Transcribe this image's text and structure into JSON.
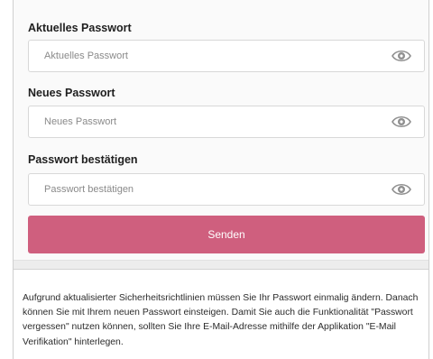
{
  "form": {
    "current": {
      "label": "Aktuelles Passwort",
      "placeholder": "Aktuelles Passwort"
    },
    "new": {
      "label": "Neues Passwort",
      "placeholder": "Neues Passwort"
    },
    "confirm": {
      "label": "Passwort bestätigen",
      "placeholder": "Passwort bestätigen"
    },
    "submit_label": "Senden"
  },
  "notice": {
    "text": "Aufgrund aktualisierter Sicherheitsrichtlinien müssen Sie Ihr Passwort einmalig ändern. Danach können Sie mit Ihrem neuen Passwort einsteigen. Damit Sie auch die Funktionalität \"Passwort vergessen\" nutzen können, sollten Sie Ihre E-Mail-Adresse mithilfe der Applikation \"E-Mail Verifikation\" hinterlegen."
  },
  "icons": {
    "show_password": "eye-icon"
  },
  "colors": {
    "accent": "#cf5f7e",
    "page_bg": "#fafafa",
    "input_border": "#d8d8d8"
  }
}
